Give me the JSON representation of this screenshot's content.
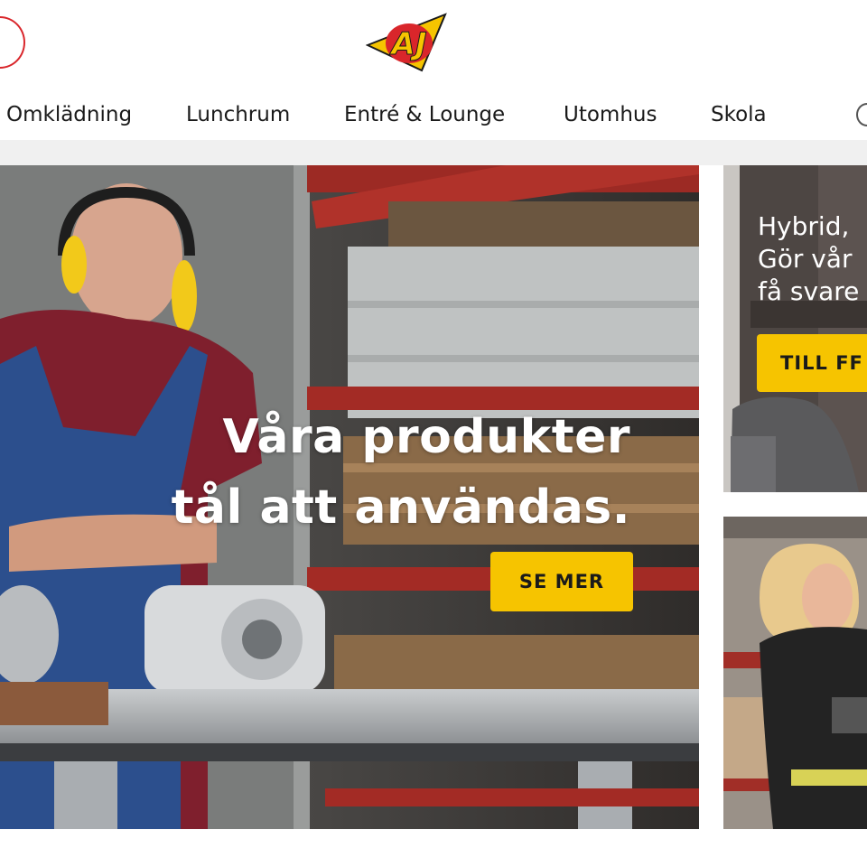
{
  "header": {
    "logo": {
      "text": "AJ",
      "icon": "aj-logo"
    },
    "nav": [
      {
        "label": "Omklädning"
      },
      {
        "label": "Lunchrum"
      },
      {
        "label": "Entré & Lounge"
      },
      {
        "label": "Utomhus"
      },
      {
        "label": "Skola"
      }
    ]
  },
  "hero": {
    "title_line1": "Våra produkter",
    "title_line2": "tål att användas.",
    "cta_label": "SE MER"
  },
  "side_card_top": {
    "line1": "Hybrid,",
    "line2": "Gör vår",
    "line3": "få svare",
    "button_label": "TILL FF"
  },
  "colors": {
    "brand_red": "#d9262b",
    "brand_yellow": "#f6c400",
    "text_dark": "#1a1a1a"
  }
}
